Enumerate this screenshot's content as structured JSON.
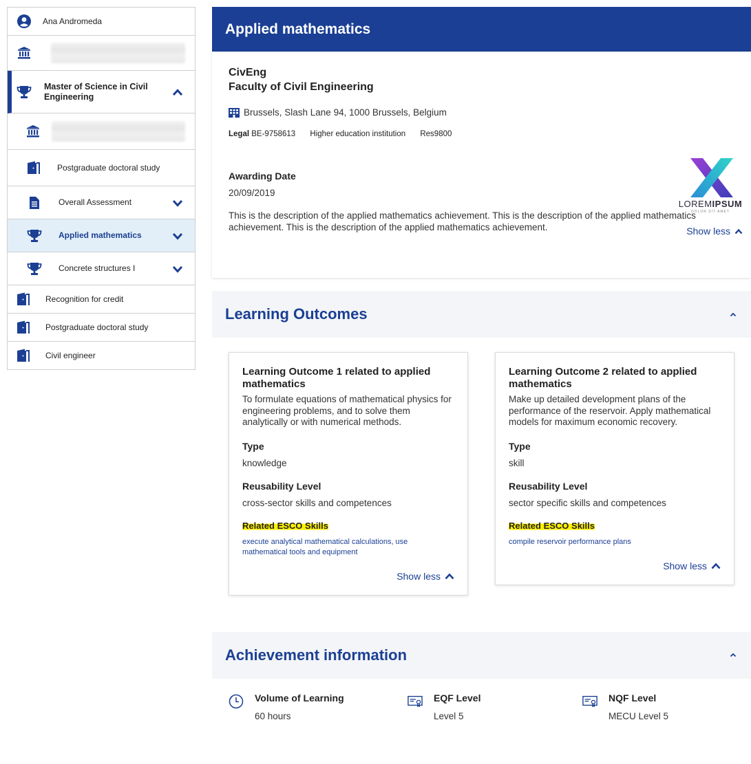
{
  "sidebar": {
    "user": "Ana Andromeda",
    "master": "Master of Science in Civil Engineering",
    "doctoral_sub": "Postgraduate doctoral study",
    "sub_items": [
      {
        "label": "Overall Assessment"
      },
      {
        "label": "Applied mathematics"
      },
      {
        "label": "Concrete structures I"
      }
    ],
    "plain_items": [
      {
        "label": "Recognition for credit"
      },
      {
        "label": "Postgraduate doctoral study"
      },
      {
        "label": "Civil engineer"
      }
    ]
  },
  "header": {
    "title": "Applied mathematics"
  },
  "achievement": {
    "org_short": "CivEng",
    "org_name": "Faculty of Civil Engineering",
    "address": "Brussels, Slash Lane 94, 1000 Brussels, Belgium",
    "legal_label": "Legal",
    "legal_id": "BE-9758613",
    "inst_type": "Higher education institution",
    "res": "Res9800",
    "logo_text_a": "LOREM",
    "logo_text_b": "IPSUM",
    "logo_tagline": "DOLOR SIT AMET",
    "show_less": "Show less",
    "awarding_label": "Awarding Date",
    "awarding_value": "20/09/2019",
    "description": "This is the description of the applied mathematics achievement. This is the description of the applied mathematics achievement. This is the description of the applied mathematics achievement."
  },
  "learning_outcomes": {
    "title": "Learning Outcomes",
    "cards": [
      {
        "title": "Learning Outcome 1 related to applied mathematics",
        "desc": "To formulate equations of mathematical physics for engineering problems, and to solve them analytically or with numerical methods.",
        "type_label": "Type",
        "type_value": "knowledge",
        "reuse_label": "Reusability Level",
        "reuse_value": "cross-sector skills and competences",
        "esco_label": "Related ESCO Skills",
        "esco_value": "execute analytical mathematical calculations, use mathematical tools and equipment",
        "show_less": "Show less"
      },
      {
        "title": "Learning Outcome 2 related to applied mathematics",
        "desc": "Make up detailed development plans of the performance of the reservoir. Apply mathematical models for maximum economic recovery.",
        "type_label": "Type",
        "type_value": "skill",
        "reuse_label": "Reusability Level",
        "reuse_value": "sector specific skills and competences",
        "esco_label": "Related ESCO Skills",
        "esco_value": "compile reservoir performance plans",
        "show_less": "Show less"
      }
    ]
  },
  "achievement_info": {
    "title": "Achievement information",
    "items": [
      {
        "label": "Volume of Learning",
        "value": "60 hours",
        "icon": "clock-icon"
      },
      {
        "label": "EQF Level",
        "value": "Level 5",
        "icon": "certificate-icon"
      },
      {
        "label": "NQF Level",
        "value": "MECU Level 5",
        "icon": "certificate-icon"
      }
    ]
  },
  "colors": {
    "brand": "#1b3f94",
    "highlight": "#fff100",
    "active_bg": "#e3eff8"
  }
}
